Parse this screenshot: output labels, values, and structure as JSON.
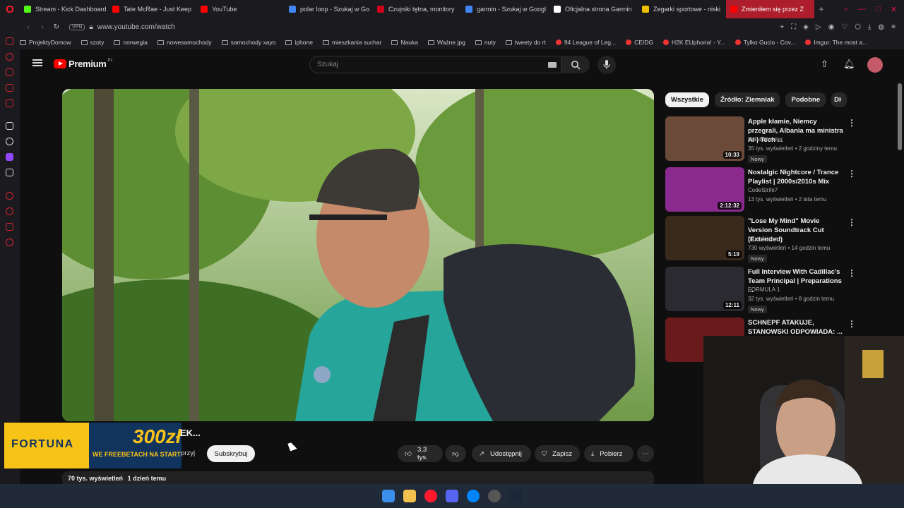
{
  "tabs": [
    {
      "label": "Stream - Kick Dashboard",
      "icon": "kick-icon",
      "color": "#53fc18"
    },
    {
      "label": "Tate McRae - Just Keep",
      "icon": "youtube-icon",
      "color": "#ff0000"
    },
    {
      "label": "YouTube",
      "icon": "youtube-icon",
      "color": "#ff0000"
    },
    {
      "label": "polar loop - Szukaj w Go",
      "icon": "google-icon",
      "color": "#4285f4"
    },
    {
      "label": "Czujniki tętna, monitory",
      "icon": "polar-icon",
      "color": "#d0021b"
    },
    {
      "label": "garmin - Szukaj w Googl",
      "icon": "google-icon",
      "color": "#4285f4"
    },
    {
      "label": "Oficjalna strona Garmin",
      "icon": "garmin-icon",
      "color": "#ffffff"
    },
    {
      "label": "Zegarki sportowe - niski",
      "icon": "store-icon",
      "color": "#f0c000"
    },
    {
      "label": "Zmieniłem się przez Z",
      "icon": "youtube-icon",
      "color": "#ff0000",
      "active": true
    }
  ],
  "address": {
    "vpn": "VPN",
    "url": "www.youtube.com/watch"
  },
  "bookmarks": [
    "ProjektyDomow",
    "szoty",
    "norwegia",
    "nowesamochody",
    "samochody xayo",
    "iphone",
    "mieszkania suchar",
    "Nauka",
    "Ważne jpg",
    "nuty",
    "tweety do rt",
    "94 League of Leg...",
    "CEIDG",
    "H2K EUphoria! - Y...",
    "Tylko Gucio - Cov...",
    "Imgur: The most a..."
  ],
  "youtube": {
    "logo_text": "Premium",
    "logo_region": "PL",
    "search_placeholder": "Szukaj"
  },
  "video": {
    "title_partial": "EK...",
    "subscribe_partial": "przyj",
    "subscribe": "Subskrybuj",
    "likes": "3,3 tys.",
    "share": "Udostępnij",
    "save": "Zapisz",
    "download": "Pobierz",
    "views": "70 tys. wyświetleń",
    "age": "1 dzień temu"
  },
  "ad": {
    "brand": "FORTUNA",
    "amount": "300zł",
    "tagline": "WE FREEBETACH NA START"
  },
  "chips": [
    "Wszystkie",
    "Źródło: Ziemniak",
    "Podobne",
    "Di"
  ],
  "recommended": [
    {
      "title": "Apple kłamie, Niemcy przegrali, Albania ma ministra AI | Tech ...",
      "channel": "Kuba Klawiter",
      "meta": "35 tys. wyświetleń • 2 godziny temu",
      "duration": "10:33",
      "badge": "Nowy",
      "thumb": "#6b4a3a"
    },
    {
      "title": "Nostalgic Nightcore / Trance Playlist | 2000s/2010s Mix",
      "channel": "CodeStrife7",
      "meta": "13 tys. wyświetleń • 2 lata temu",
      "duration": "2:12:32",
      "badge": "",
      "thumb": "#8a2a8e"
    },
    {
      "title": "\"Lose My Mind\" Movie Version Soundtrack Cut (Extended)",
      "channel": "brunofalcon",
      "meta": "730 wyświetleń • 14 godzin temu",
      "duration": "5:19",
      "badge": "Nowy",
      "thumb": "#3a2a1c"
    },
    {
      "title": "Full Interview With Cadillac's Team Principal | Preparations ...",
      "channel": "FORMULA 1",
      "meta": "32 tys. wyświetleń • 8 godzin temu",
      "duration": "12:11",
      "badge": "Nowy",
      "thumb": "#2a2a30"
    },
    {
      "title": "SCHNEPF ATAKUJE, STANOWSKI ODPOWIADA: ...",
      "channel": "",
      "meta": "",
      "duration": "",
      "badge": "",
      "thumb": "#6a1a1a"
    }
  ]
}
